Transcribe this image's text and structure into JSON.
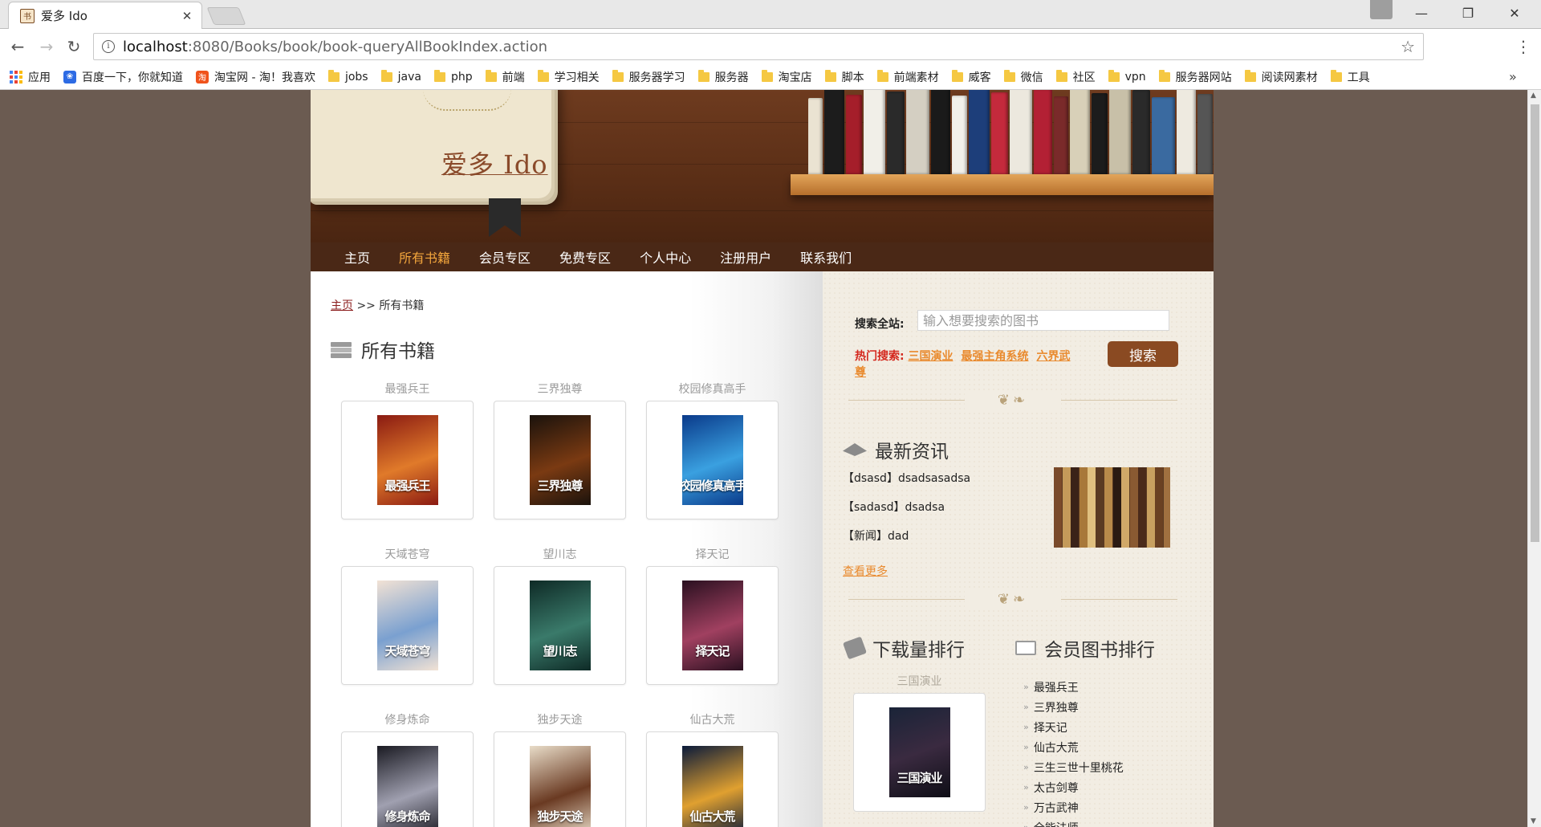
{
  "browser": {
    "tab_title": "爱多 Ido",
    "url_host": "localhost",
    "url_rest": ":8080/Books/book/book-queryAllBookIndex.action",
    "bookmarks": [
      {
        "label": "应用",
        "icon": "apps"
      },
      {
        "label": "百度一下，你就知道",
        "icon": "baidu"
      },
      {
        "label": "淘宝网 - 淘！我喜欢",
        "icon": "taobao"
      },
      {
        "label": "jobs",
        "icon": "folder"
      },
      {
        "label": "java",
        "icon": "folder"
      },
      {
        "label": "php",
        "icon": "folder"
      },
      {
        "label": "前端",
        "icon": "folder"
      },
      {
        "label": "学习相关",
        "icon": "folder"
      },
      {
        "label": "服务器学习",
        "icon": "folder"
      },
      {
        "label": "服务器",
        "icon": "folder"
      },
      {
        "label": "淘宝店",
        "icon": "folder"
      },
      {
        "label": "脚本",
        "icon": "folder"
      },
      {
        "label": "前端素材",
        "icon": "folder"
      },
      {
        "label": "威客",
        "icon": "folder"
      },
      {
        "label": "微信",
        "icon": "folder"
      },
      {
        "label": "社区",
        "icon": "folder"
      },
      {
        "label": "vpn",
        "icon": "folder"
      },
      {
        "label": "服务器网站",
        "icon": "folder"
      },
      {
        "label": "阅读网素材",
        "icon": "folder"
      },
      {
        "label": "工具",
        "icon": "folder"
      }
    ]
  },
  "site": {
    "logo": "爱多 Ido",
    "nav": [
      {
        "label": "主页",
        "active": false
      },
      {
        "label": "所有书籍",
        "active": true
      },
      {
        "label": "会员专区",
        "active": false
      },
      {
        "label": "免费专区",
        "active": false
      },
      {
        "label": "个人中心",
        "active": false
      },
      {
        "label": "注册用户",
        "active": false
      },
      {
        "label": "联系我们",
        "active": false
      }
    ],
    "accent_color": "#f3a63c",
    "brand_brown": "#8a4a22"
  },
  "main": {
    "breadcrumb_home": "主页",
    "breadcrumb_rest": " >> 所有书籍",
    "section_title": "所有书籍",
    "books": [
      {
        "title": "最强兵王",
        "cover_text": "最强兵王",
        "c1": "#8a1a12",
        "c2": "#e07a2a"
      },
      {
        "title": "三界独尊",
        "cover_text": "三界独尊",
        "c1": "#1a120c",
        "c2": "#7a3a12"
      },
      {
        "title": "校园修真高手",
        "cover_text": "校园修真高手",
        "c1": "#0a3a8a",
        "c2": "#3aa0e0"
      },
      {
        "title": "天域苍穹",
        "cover_text": "天域苍穹",
        "c1": "#f2e2d4",
        "c2": "#7aa0d0"
      },
      {
        "title": "望川志",
        "cover_text": "望川志",
        "c1": "#0e2a26",
        "c2": "#3a7a6a"
      },
      {
        "title": "择天记",
        "cover_text": "择天记",
        "c1": "#2a1020",
        "c2": "#a04060"
      },
      {
        "title": "修身炼命",
        "cover_text": "修身炼命",
        "c1": "#1a1a22",
        "c2": "#a0a0b0"
      },
      {
        "title": "独步天途",
        "cover_text": "独步天途",
        "c1": "#e8dcc8",
        "c2": "#6a3a22"
      },
      {
        "title": "仙古大荒",
        "cover_text": "仙古大荒",
        "c1": "#0a1a3a",
        "c2": "#e0a030"
      }
    ]
  },
  "sidebar": {
    "search_label": "搜索全站:",
    "search_placeholder": "输入想要搜索的图书",
    "hot_label": "热门搜索:",
    "hot_items": [
      "三国演业",
      "最强主角系统",
      "六界武尊"
    ],
    "search_button": "搜索",
    "news_title": "最新资讯",
    "news": [
      "【dsasd】dsadsasadsa",
      "【sadasd】dsadsa",
      "【新闻】dad"
    ],
    "news_more": "查看更多",
    "download_title": "下载量排行",
    "download_top": {
      "title": "三国演业",
      "cover_text": "三国演业"
    },
    "vip_title": "会员图书排行",
    "vip_list": [
      "最强兵王",
      "三界独尊",
      "择天记",
      "仙古大荒",
      "三生三世十里桃花",
      "太古剑尊",
      "万古武神",
      "全能法师"
    ]
  }
}
